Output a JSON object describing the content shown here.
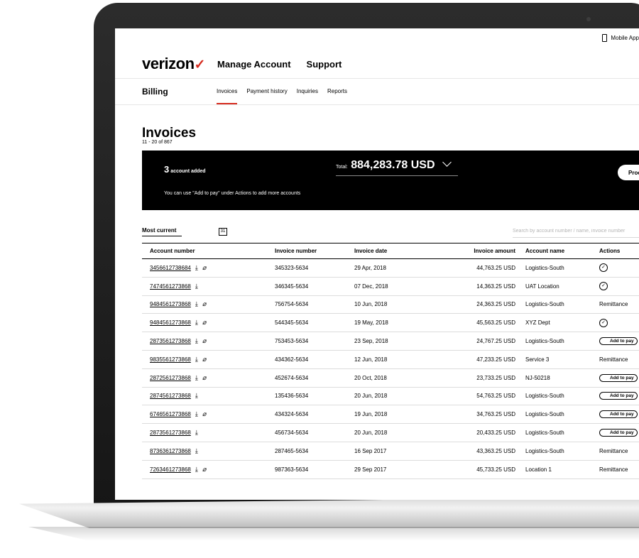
{
  "utility": {
    "mobile_app": "Mobile App"
  },
  "header": {
    "logo": "verizon",
    "logo_mark": "✓",
    "nav": [
      "Manage Account",
      "Support"
    ]
  },
  "subnav": {
    "section": "Billing",
    "tabs": [
      "Invoices",
      "Payment history",
      "Inquiries",
      "Reports"
    ],
    "active_tab": "Invoices"
  },
  "page": {
    "title": "Invoices",
    "count": "11 - 20 of 867"
  },
  "banner": {
    "added_count": "3",
    "added_label": "account added",
    "total_label": "Total:",
    "total_value": "884,283.78 USD",
    "hint": "You can use \"Add to pay\" under Actions to add more accounts",
    "proceed": "Proceed"
  },
  "filters": {
    "sort": "Most current",
    "calendar_day": "31",
    "search_placeholder": "Search by account number / name, invoice number"
  },
  "table": {
    "columns": [
      "Account number",
      "Invoice number",
      "Invoice date",
      "Invoice amount",
      "Account name",
      "Actions"
    ],
    "rows": [
      {
        "account": "3456612738684",
        "has_attachment": true,
        "invoice": "345323-5634",
        "date": "29 Apr, 2018",
        "amount": "44,763.25 USD",
        "name": "Logistics-South",
        "action": {
          "type": "check",
          "label": ""
        }
      },
      {
        "account": "7474561273868",
        "has_attachment": false,
        "invoice": "346345-5634",
        "date": "07 Dec, 2018",
        "amount": "14,363.25 USD",
        "name": "UAT Location",
        "action": {
          "type": "check",
          "label": ""
        }
      },
      {
        "account": "9484561273868",
        "has_attachment": true,
        "invoice": "756754-5634",
        "date": "10 Jun, 2018",
        "amount": "24,363.25 USD",
        "name": "Logistics-South",
        "action": {
          "type": "text",
          "label": "Remittance"
        }
      },
      {
        "account": "9484561273868",
        "has_attachment": true,
        "invoice": "544345-5634",
        "date": "19 May, 2018",
        "amount": "45,563.25 USD",
        "name": "XYZ Dept",
        "action": {
          "type": "check",
          "label": ""
        }
      },
      {
        "account": "2873561273868",
        "has_attachment": true,
        "invoice": "753453-5634",
        "date": "23 Sep, 2018",
        "amount": "24,767.25 USD",
        "name": "Logistics-South",
        "action": {
          "type": "button",
          "label": "Add to pay"
        }
      },
      {
        "account": "9835561273868",
        "has_attachment": true,
        "invoice": "434362-5634",
        "date": "12 Jun, 2018",
        "amount": "47,233.25 USD",
        "name": "Service 3",
        "action": {
          "type": "text",
          "label": "Remittance"
        }
      },
      {
        "account": "2872561273868",
        "has_attachment": true,
        "invoice": "452674-5634",
        "date": "20 Oct, 2018",
        "amount": "23,733.25 USD",
        "name": "NJ-50218",
        "action": {
          "type": "button",
          "label": "Add to pay"
        }
      },
      {
        "account": "2874561273868",
        "has_attachment": false,
        "invoice": "135436-5634",
        "date": "20 Jun, 2018",
        "amount": "54,763.25 USD",
        "name": "Logistics-South",
        "action": {
          "type": "button",
          "label": "Add to pay"
        }
      },
      {
        "account": "6746561273868",
        "has_attachment": true,
        "invoice": "434324-5634",
        "date": "19 Jun, 2018",
        "amount": "34,763.25 USD",
        "name": "Logistics-South",
        "action": {
          "type": "button",
          "label": "Add to pay"
        }
      },
      {
        "account": "2873561273868",
        "has_attachment": false,
        "invoice": "456734-5634",
        "date": "20 Jun, 2018",
        "amount": "20,433.25 USD",
        "name": "Logistics-South",
        "action": {
          "type": "button",
          "label": "Add to pay"
        }
      },
      {
        "account": "8736361273868",
        "has_attachment": false,
        "invoice": "287465-5634",
        "date": "16 Sep 2017",
        "amount": "43,363.25 USD",
        "name": "Logistics-South",
        "action": {
          "type": "text",
          "label": "Remittance"
        }
      },
      {
        "account": "7263461273868",
        "has_attachment": true,
        "invoice": "987363-5634",
        "date": "29 Sep 2017",
        "amount": "45,733.25 USD",
        "name": "Location 1",
        "action": {
          "type": "text",
          "label": "Remittance"
        }
      }
    ]
  },
  "colors": {
    "accent": "#d52b1e",
    "banner_bg": "#000000"
  },
  "icons": {
    "download": "download-icon",
    "attachment": "paperclip-icon",
    "check": "check-circle-icon",
    "calendar": "calendar-icon",
    "phone": "phone-icon",
    "chevron": "chevron-down-icon"
  }
}
